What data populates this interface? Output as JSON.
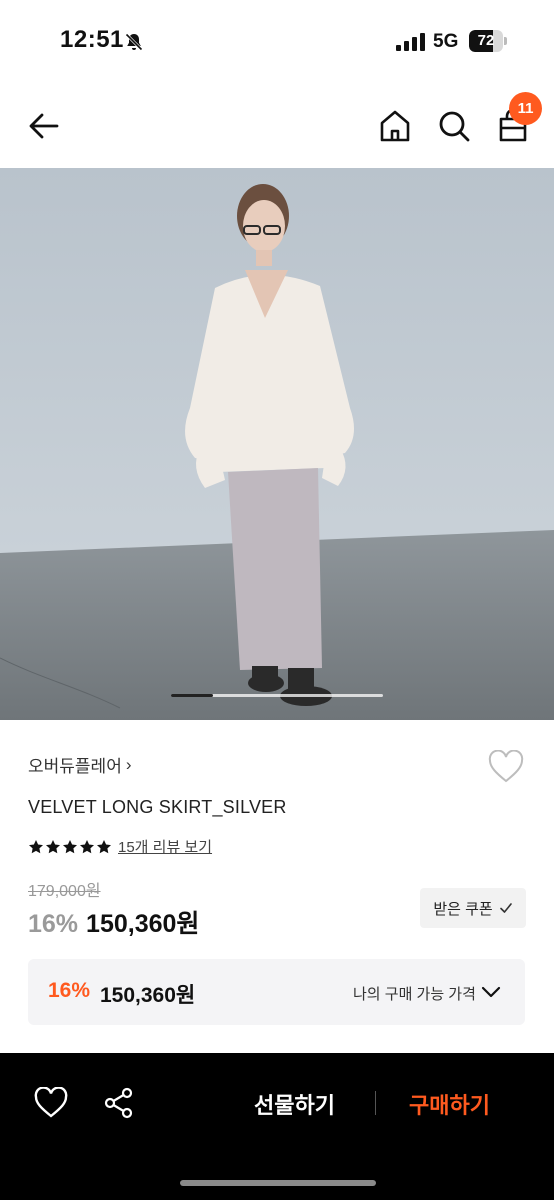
{
  "status_bar": {
    "time": "12:51",
    "network": "5G",
    "battery": "72",
    "battery_level": 0.72
  },
  "header": {
    "cart_count": "11"
  },
  "image": {
    "slide_position": 0.2
  },
  "product": {
    "brand": "오버듀플레어",
    "brand_chevron": "›",
    "title": "VELVET LONG SKIRT_SILVER",
    "rating": 5,
    "review_link": "15개 리뷰 보기",
    "original_price": "179,000원",
    "discount": "16%",
    "price": "150,360원",
    "coupon_label": "받은 쿠폰"
  },
  "my_price": {
    "discount": "16%",
    "price": "150,360원",
    "label": "나의 구매 가능 가격"
  },
  "bottom_bar": {
    "gift_label": "선물하기",
    "buy_label": "구매하기"
  },
  "colors": {
    "accent": "#ff5a1f",
    "bottom_bar": "#000000"
  },
  "icons": [
    "back-arrow-icon",
    "home-icon",
    "search-icon",
    "shopping-bag-icon",
    "heart-icon",
    "star-icon",
    "check-icon",
    "chevron-down-icon",
    "share-icon",
    "bell-slash-icon",
    "signal-icon",
    "battery-icon"
  ]
}
